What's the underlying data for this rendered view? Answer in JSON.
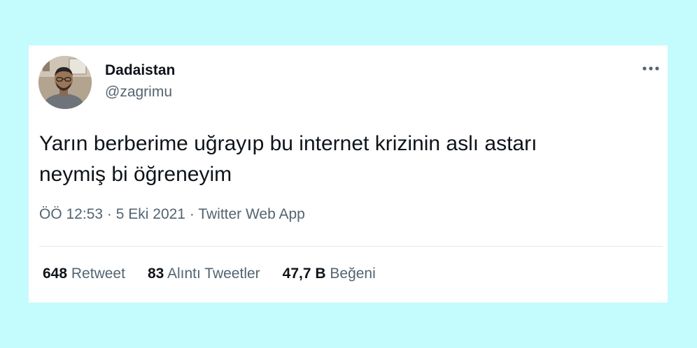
{
  "tweet": {
    "author_name": "Dadaistan",
    "author_handle": "@zagrimu",
    "text_line1": "Yarın berberime uğrayıp bu internet krizinin aslı astarı",
    "text_line2": "neymiş bi öğreneyim",
    "time": "ÖÖ 12:53",
    "separator": "·",
    "date": "5 Eki 2021",
    "source": "Twitter Web App",
    "more_icon": "more-horizontal-icon"
  },
  "stats": [
    {
      "count": "648",
      "label": "Retweet"
    },
    {
      "count": "83",
      "label": "Alıntı Tweetler"
    },
    {
      "count": "47,7 B",
      "label": "Beğeni"
    }
  ],
  "colors": {
    "page_background": "#c4fbfd",
    "card_background": "#ffffff",
    "text_primary": "#0f1419",
    "text_secondary": "#536471",
    "divider": "#e4e8eb"
  }
}
